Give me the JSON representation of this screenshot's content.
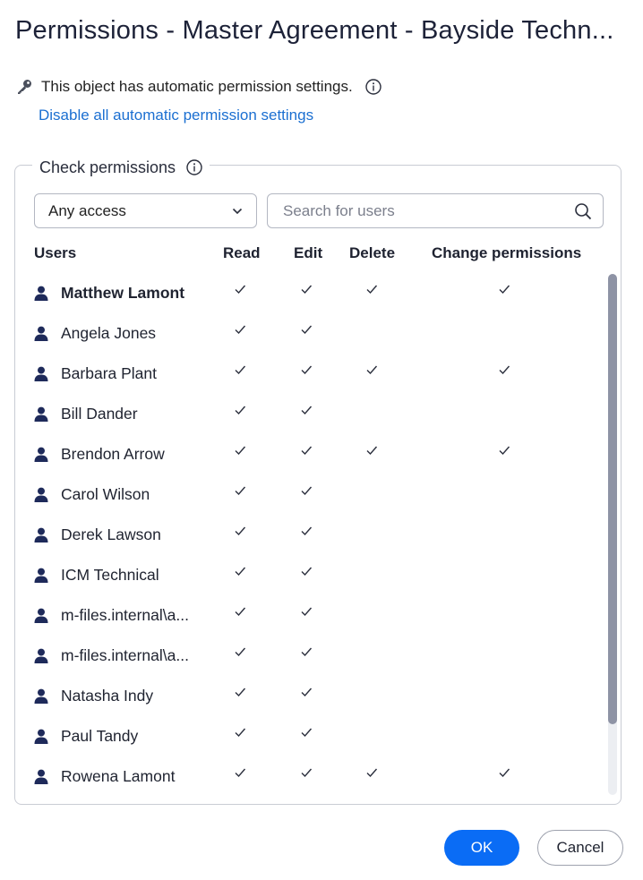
{
  "dialog": {
    "title": "Permissions - Master Agreement - Bayside Techn..."
  },
  "automatic": {
    "text": "This object has automatic permission settings.",
    "disable_link": "Disable all automatic permission settings"
  },
  "check": {
    "legend": "Check permissions",
    "filter_value": "Any access",
    "search_placeholder": "Search for users",
    "columns": {
      "users": "Users",
      "read": "Read",
      "edit": "Edit",
      "delete": "Delete",
      "change": "Change permissions"
    },
    "users": [
      {
        "name": "Matthew Lamont",
        "bold": true,
        "read": true,
        "edit": true,
        "delete": true,
        "change": true
      },
      {
        "name": "Angela Jones",
        "bold": false,
        "read": true,
        "edit": true,
        "delete": false,
        "change": false
      },
      {
        "name": "Barbara Plant",
        "bold": false,
        "read": true,
        "edit": true,
        "delete": true,
        "change": true
      },
      {
        "name": "Bill Dander",
        "bold": false,
        "read": true,
        "edit": true,
        "delete": false,
        "change": false
      },
      {
        "name": "Brendon Arrow",
        "bold": false,
        "read": true,
        "edit": true,
        "delete": true,
        "change": true
      },
      {
        "name": "Carol Wilson",
        "bold": false,
        "read": true,
        "edit": true,
        "delete": false,
        "change": false
      },
      {
        "name": "Derek Lawson",
        "bold": false,
        "read": true,
        "edit": true,
        "delete": false,
        "change": false
      },
      {
        "name": "ICM Technical",
        "bold": false,
        "read": true,
        "edit": true,
        "delete": false,
        "change": false
      },
      {
        "name": "m-files.internal\\a...",
        "bold": false,
        "read": true,
        "edit": true,
        "delete": false,
        "change": false
      },
      {
        "name": "m-files.internal\\a...",
        "bold": false,
        "read": true,
        "edit": true,
        "delete": false,
        "change": false
      },
      {
        "name": "Natasha Indy",
        "bold": false,
        "read": true,
        "edit": true,
        "delete": false,
        "change": false
      },
      {
        "name": "Paul Tandy",
        "bold": false,
        "read": true,
        "edit": true,
        "delete": false,
        "change": false
      },
      {
        "name": "Rowena Lamont",
        "bold": false,
        "read": true,
        "edit": true,
        "delete": true,
        "change": true
      }
    ]
  },
  "buttons": {
    "ok": "OK",
    "cancel": "Cancel"
  },
  "colors": {
    "link": "#1b6fd1",
    "primary": "#0a6cf5",
    "user_icon": "#1e2a5a"
  },
  "icons": [
    "key-icon",
    "info-icon",
    "chevron-down-icon",
    "search-icon",
    "user-icon",
    "check-icon"
  ]
}
